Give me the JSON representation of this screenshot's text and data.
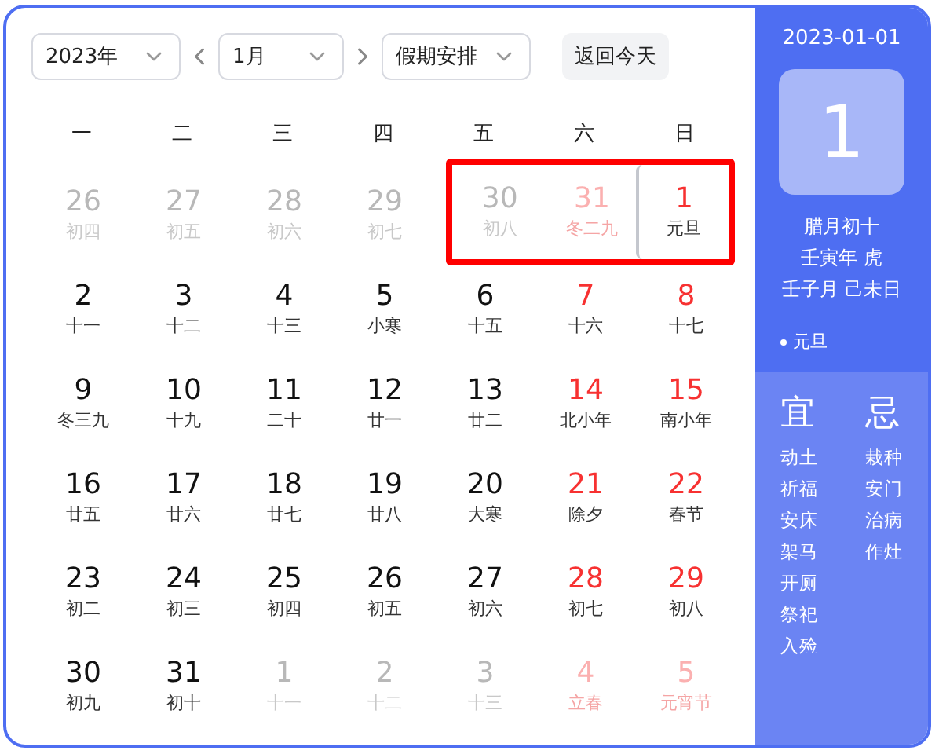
{
  "toolbar": {
    "year_select": "2023年",
    "month_select": "1月",
    "holiday_select": "假期安排",
    "today_button": "返回今天"
  },
  "weekdays": [
    "一",
    "二",
    "三",
    "四",
    "五",
    "六",
    "日"
  ],
  "weeks": [
    [
      {
        "day": "26",
        "lunar": "初四",
        "other_month": true,
        "weekend": false,
        "selected": false,
        "highlighted": false
      },
      {
        "day": "27",
        "lunar": "初五",
        "other_month": true,
        "weekend": false,
        "selected": false,
        "highlighted": false
      },
      {
        "day": "28",
        "lunar": "初六",
        "other_month": true,
        "weekend": false,
        "selected": false,
        "highlighted": false
      },
      {
        "day": "29",
        "lunar": "初七",
        "other_month": true,
        "weekend": false,
        "selected": false,
        "highlighted": false
      },
      {
        "day": "30",
        "lunar": "初八",
        "other_month": true,
        "weekend": false,
        "selected": false,
        "highlighted": true
      },
      {
        "day": "31",
        "lunar": "冬二九",
        "other_month": true,
        "weekend": true,
        "selected": false,
        "highlighted": true
      },
      {
        "day": "1",
        "lunar": "元旦",
        "other_month": false,
        "weekend": true,
        "selected": true,
        "highlighted": true
      }
    ],
    [
      {
        "day": "2",
        "lunar": "十一",
        "other_month": false,
        "weekend": false,
        "selected": false,
        "highlighted": false
      },
      {
        "day": "3",
        "lunar": "十二",
        "other_month": false,
        "weekend": false,
        "selected": false,
        "highlighted": false
      },
      {
        "day": "4",
        "lunar": "十三",
        "other_month": false,
        "weekend": false,
        "selected": false,
        "highlighted": false
      },
      {
        "day": "5",
        "lunar": "小寒",
        "other_month": false,
        "weekend": false,
        "selected": false,
        "highlighted": false
      },
      {
        "day": "6",
        "lunar": "十五",
        "other_month": false,
        "weekend": false,
        "selected": false,
        "highlighted": false
      },
      {
        "day": "7",
        "lunar": "十六",
        "other_month": false,
        "weekend": true,
        "selected": false,
        "highlighted": false
      },
      {
        "day": "8",
        "lunar": "十七",
        "other_month": false,
        "weekend": true,
        "selected": false,
        "highlighted": false
      }
    ],
    [
      {
        "day": "9",
        "lunar": "冬三九",
        "other_month": false,
        "weekend": false,
        "selected": false,
        "highlighted": false
      },
      {
        "day": "10",
        "lunar": "十九",
        "other_month": false,
        "weekend": false,
        "selected": false,
        "highlighted": false
      },
      {
        "day": "11",
        "lunar": "二十",
        "other_month": false,
        "weekend": false,
        "selected": false,
        "highlighted": false
      },
      {
        "day": "12",
        "lunar": "廿一",
        "other_month": false,
        "weekend": false,
        "selected": false,
        "highlighted": false
      },
      {
        "day": "13",
        "lunar": "廿二",
        "other_month": false,
        "weekend": false,
        "selected": false,
        "highlighted": false
      },
      {
        "day": "14",
        "lunar": "北小年",
        "other_month": false,
        "weekend": true,
        "selected": false,
        "highlighted": false
      },
      {
        "day": "15",
        "lunar": "南小年",
        "other_month": false,
        "weekend": true,
        "selected": false,
        "highlighted": false
      }
    ],
    [
      {
        "day": "16",
        "lunar": "廿五",
        "other_month": false,
        "weekend": false,
        "selected": false,
        "highlighted": false
      },
      {
        "day": "17",
        "lunar": "廿六",
        "other_month": false,
        "weekend": false,
        "selected": false,
        "highlighted": false
      },
      {
        "day": "18",
        "lunar": "廿七",
        "other_month": false,
        "weekend": false,
        "selected": false,
        "highlighted": false
      },
      {
        "day": "19",
        "lunar": "廿八",
        "other_month": false,
        "weekend": false,
        "selected": false,
        "highlighted": false
      },
      {
        "day": "20",
        "lunar": "大寒",
        "other_month": false,
        "weekend": false,
        "selected": false,
        "highlighted": false
      },
      {
        "day": "21",
        "lunar": "除夕",
        "other_month": false,
        "weekend": true,
        "selected": false,
        "highlighted": false
      },
      {
        "day": "22",
        "lunar": "春节",
        "other_month": false,
        "weekend": true,
        "selected": false,
        "highlighted": false
      }
    ],
    [
      {
        "day": "23",
        "lunar": "初二",
        "other_month": false,
        "weekend": false,
        "selected": false,
        "highlighted": false
      },
      {
        "day": "24",
        "lunar": "初三",
        "other_month": false,
        "weekend": false,
        "selected": false,
        "highlighted": false
      },
      {
        "day": "25",
        "lunar": "初四",
        "other_month": false,
        "weekend": false,
        "selected": false,
        "highlighted": false
      },
      {
        "day": "26",
        "lunar": "初五",
        "other_month": false,
        "weekend": false,
        "selected": false,
        "highlighted": false
      },
      {
        "day": "27",
        "lunar": "初六",
        "other_month": false,
        "weekend": false,
        "selected": false,
        "highlighted": false
      },
      {
        "day": "28",
        "lunar": "初七",
        "other_month": false,
        "weekend": true,
        "selected": false,
        "highlighted": false
      },
      {
        "day": "29",
        "lunar": "初八",
        "other_month": false,
        "weekend": true,
        "selected": false,
        "highlighted": false
      }
    ],
    [
      {
        "day": "30",
        "lunar": "初九",
        "other_month": false,
        "weekend": false,
        "selected": false,
        "highlighted": false
      },
      {
        "day": "31",
        "lunar": "初十",
        "other_month": false,
        "weekend": false,
        "selected": false,
        "highlighted": false
      },
      {
        "day": "1",
        "lunar": "十一",
        "other_month": true,
        "weekend": false,
        "selected": false,
        "highlighted": false
      },
      {
        "day": "2",
        "lunar": "十二",
        "other_month": true,
        "weekend": false,
        "selected": false,
        "highlighted": false
      },
      {
        "day": "3",
        "lunar": "十三",
        "other_month": true,
        "weekend": false,
        "selected": false,
        "highlighted": false
      },
      {
        "day": "4",
        "lunar": "立春",
        "other_month": true,
        "weekend": true,
        "selected": false,
        "highlighted": false
      },
      {
        "day": "5",
        "lunar": "元宵节",
        "other_month": true,
        "weekend": true,
        "selected": false,
        "highlighted": false
      }
    ]
  ],
  "detail": {
    "date": "2023-01-01",
    "day": "1",
    "lunar_date": "腊月初十",
    "year_ganzhi": "壬寅年 虎",
    "month_day_ganzhi": "壬子月 己未日",
    "festivals": [
      "元旦"
    ],
    "good_title": "宜",
    "good": [
      "动土",
      "祈福",
      "安床",
      "架马",
      "开厕",
      "祭祀",
      "入殓"
    ],
    "bad_title": "忌",
    "bad": [
      "栽种",
      "安门",
      "治病",
      "作灶"
    ]
  }
}
